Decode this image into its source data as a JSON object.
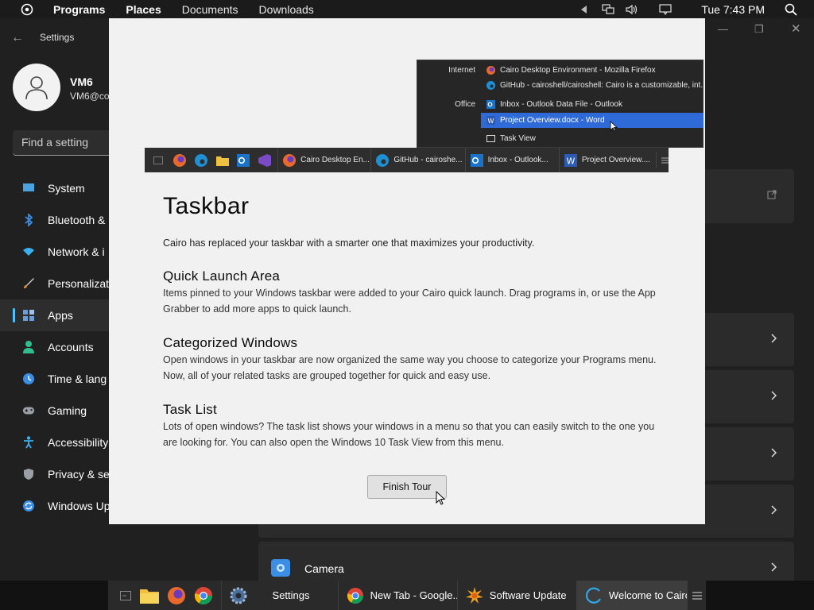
{
  "menubar": {
    "items": [
      "Programs",
      "Places",
      "Documents",
      "Downloads"
    ],
    "clock": "Tue 7:43 PM"
  },
  "settings": {
    "title": "Settings",
    "user_name": "VM6",
    "user_email": "VM6@co",
    "search_placeholder": "Find a setting",
    "nav": [
      {
        "label": "System",
        "icon": "monitor-icon",
        "color": "#4aa3df"
      },
      {
        "label": "Bluetooth &",
        "icon": "bluetooth-icon",
        "color": "#3a8ee6"
      },
      {
        "label": "Network & i",
        "icon": "wifi-icon",
        "color": "#3ab0f0"
      },
      {
        "label": "Personalizati",
        "icon": "brush-icon",
        "color": "#e08a3c"
      },
      {
        "label": "Apps",
        "icon": "apps-icon",
        "color": "#6a9ed8"
      },
      {
        "label": "Accounts",
        "icon": "person-icon",
        "color": "#2fbf8f"
      },
      {
        "label": "Time & lang",
        "icon": "globe-icon",
        "color": "#3a8ee6"
      },
      {
        "label": "Gaming",
        "icon": "gamepad-icon",
        "color": "#9aa0a6"
      },
      {
        "label": "Accessibility",
        "icon": "accessibility-icon",
        "color": "#3ab0f0"
      },
      {
        "label": "Privacy & se",
        "icon": "shield-icon",
        "color": "#9aa0a6"
      },
      {
        "label": "Windows Up",
        "icon": "update-icon",
        "color": "#3a8ee6"
      }
    ],
    "camera_label": "Camera"
  },
  "dialog": {
    "preview": {
      "popup_categories": [
        "Internet",
        "Office"
      ],
      "popup_rows": [
        {
          "label": "Cairo Desktop Environment - Mozilla Firefox",
          "icon": "firefox-icon"
        },
        {
          "label": "GitHub - cairoshell/cairoshell: Cairo is a customizable, int...",
          "icon": "edge-icon"
        },
        {
          "label": "Inbox - Outlook Data File - Outlook",
          "icon": "outlook-icon"
        },
        {
          "label": "Project Overview.docx - Word",
          "icon": "word-icon"
        },
        {
          "label": "Task View",
          "icon": "task-view-icon"
        }
      ],
      "mini_tasks": [
        {
          "label": "Cairo Desktop En...",
          "icon": "firefox-icon"
        },
        {
          "label": "GitHub - cairoshe...",
          "icon": "edge-icon"
        },
        {
          "label": "Inbox - Outlook...",
          "icon": "outlook-icon"
        },
        {
          "label": "Project Overview....",
          "icon": "word-icon"
        }
      ]
    },
    "title": "Taskbar",
    "intro": "Cairo has replaced your taskbar with a smarter one that maximizes your productivity.",
    "sections": [
      {
        "heading": "Quick Launch Area",
        "text": "Items pinned to your Windows taskbar were added to your Cairo quick launch. Drag programs in, or use the App Grabber to add more apps to quick launch."
      },
      {
        "heading": "Categorized Windows",
        "text": "Open windows in your taskbar are now organized the same way you choose to categorize your Programs menu. Now, all of your related tasks are grouped together for quick and easy use."
      },
      {
        "heading": "Task List",
        "text": "Lots of open windows? The task list shows your windows in a menu so that you can easily switch to the one you are looking for. You can also open the Windows 10 Task View from this menu."
      }
    ],
    "finish_label": "Finish Tour"
  },
  "taskbar": {
    "tasks": [
      {
        "label": "Settings",
        "icon": "gear-icon"
      },
      {
        "label": "New Tab - Google...",
        "icon": "chrome-icon"
      },
      {
        "label": "Software Update",
        "icon": "sun-update-icon"
      },
      {
        "label": "Welcome to Cairo",
        "icon": "cairo-icon"
      }
    ]
  },
  "colors": {
    "accent": "#4cc2ff",
    "selection": "#2f6bd8"
  }
}
